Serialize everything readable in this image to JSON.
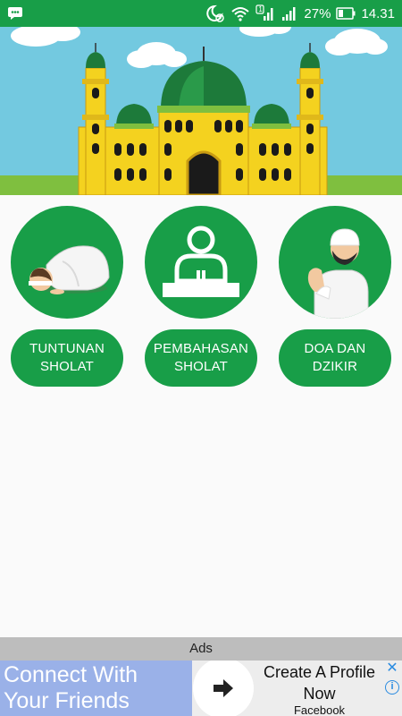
{
  "status_bar": {
    "notification_icon": "chat-bubble-icon",
    "signal_sim1": "1",
    "battery_percent": "27%",
    "time": "14.31"
  },
  "header": {
    "image": "mosque-illustration"
  },
  "menu": {
    "items": [
      {
        "icon": "prostrating-man-icon",
        "label_line1": "TUNTUNAN",
        "label_line2": "SHOLAT"
      },
      {
        "icon": "khatib-podium-icon",
        "label_line1": "PEMBAHASAN",
        "label_line2": "SHOLAT"
      },
      {
        "icon": "praying-man-icon",
        "label_line1": "DOA DAN",
        "label_line2": "DZIKIR"
      }
    ]
  },
  "ads": {
    "bar_label": "Ads",
    "left_text_line1": "Connect With",
    "left_text_line2": "Your Friends",
    "cta_title_line1": "Create A Profile",
    "cta_title_line2": "Now",
    "advertiser": "Facebook",
    "close_symbol": "✕",
    "info_symbol": "i"
  },
  "colors": {
    "primary_green": "#189e48",
    "sky": "#73c9e0",
    "mosque_yellow": "#f4d21f",
    "dome_green": "#1d7a3a",
    "ad_blue": "#9ab1e8"
  }
}
